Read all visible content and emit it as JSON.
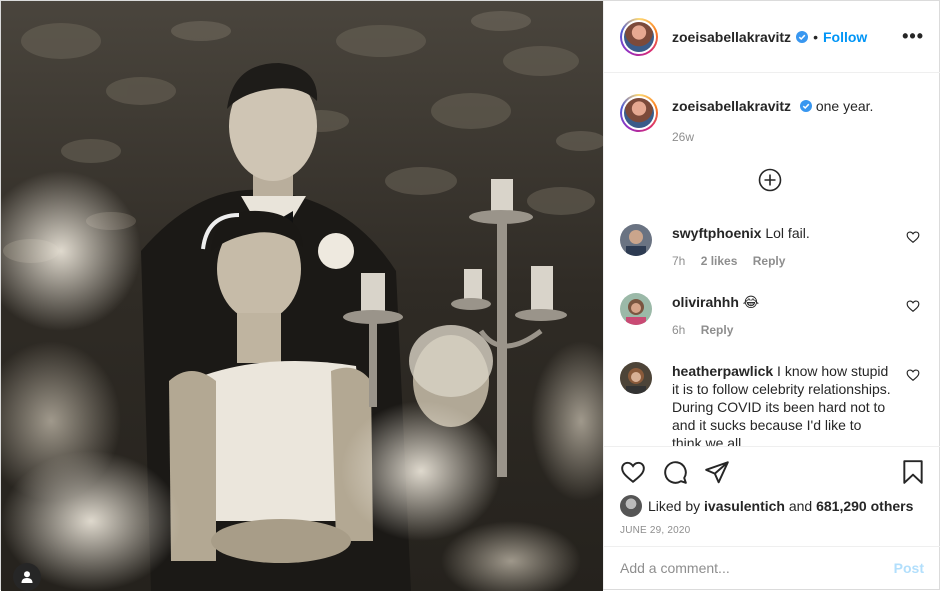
{
  "post": {
    "username": "zoeisabellakravitz",
    "separator": "•",
    "follow_label": "Follow",
    "more_label": "•••"
  },
  "caption": {
    "username": "zoeisabellakravitz",
    "text": "one year.",
    "age": "26w"
  },
  "comments": [
    {
      "username": "swyftphoenix",
      "text": "Lol fail.",
      "age": "7h",
      "likes": "2 likes",
      "reply": "Reply"
    },
    {
      "username": "olivirahhh",
      "text": "😂",
      "age": "6h",
      "reply": "Reply"
    },
    {
      "username": "heatherpawlick",
      "text": "I know how stupid it is to follow celebrity relationships. During COVID its been hard not to and it sucks because I'd like to think we all"
    }
  ],
  "likes": {
    "prefix": "Liked by",
    "user": "ivasulentich",
    "joiner": "and",
    "others": "681,290 others"
  },
  "date": "JUNE 29, 2020",
  "comment_box": {
    "placeholder": "Add a comment...",
    "post_label": "Post"
  },
  "colors": {
    "accent": "#0095f6",
    "post_disabled": "#b2dffc",
    "muted": "#8e8e8e"
  },
  "icons": [
    "person-tag-icon",
    "verified-badge-icon",
    "more-options-icon",
    "add-circle-icon",
    "heart-icon",
    "comment-icon",
    "share-icon",
    "bookmark-icon"
  ]
}
